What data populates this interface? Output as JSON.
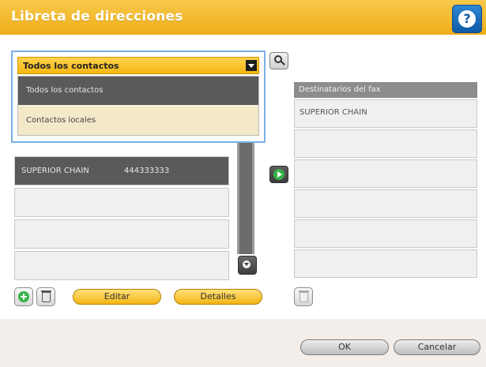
{
  "header": {
    "title": "Libreta de direcciones",
    "help_icon": "help-icon"
  },
  "contacts_filter": {
    "selected": "Todos los contactos",
    "options": [
      "Todos los contactos",
      "Contactos locales"
    ]
  },
  "contacts_list": {
    "rows": [
      {
        "name": "SUPERIOR CHAIN",
        "number": "444333333",
        "selected": true
      },
      {
        "name": "",
        "number": ""
      },
      {
        "name": "",
        "number": ""
      },
      {
        "name": "",
        "number": ""
      }
    ]
  },
  "fax_recipients": {
    "header": "Destinatarios del fax",
    "rows": [
      "SUPERIOR CHAIN",
      "",
      "",
      "",
      "",
      ""
    ]
  },
  "toolbar": {
    "edit_label": "Editar",
    "details_label": "Detalles"
  },
  "footer": {
    "ok_label": "OK",
    "cancel_label": "Cancelar"
  },
  "colors": {
    "title_bar": "#f0ae19",
    "help_button": "#0f5aa6",
    "accent_green": "#36b34a",
    "selected_row": "#5a5a5a"
  }
}
